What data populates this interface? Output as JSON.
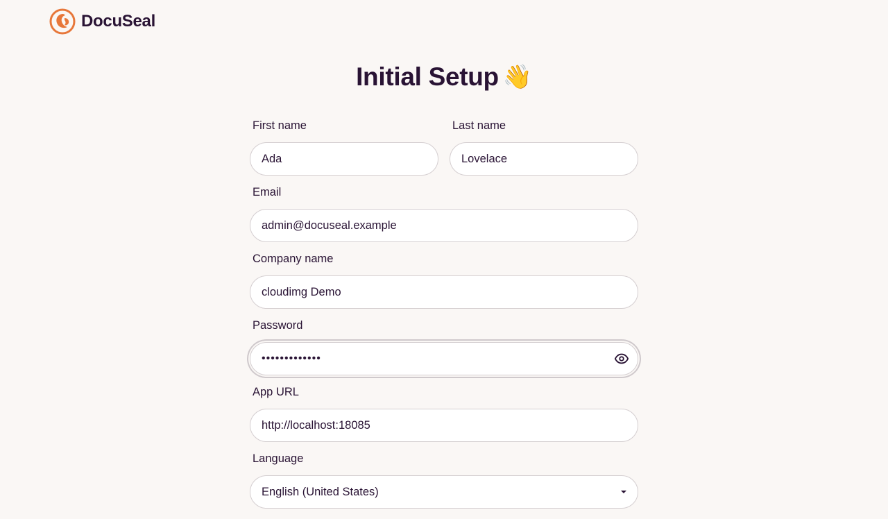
{
  "header": {
    "brand": "DocuSeal",
    "logo_icon": "docuseal-logo-icon",
    "accent_color": "#e7773a"
  },
  "page": {
    "title": "Initial Setup",
    "title_emoji": "👋"
  },
  "form": {
    "first_name": {
      "label": "First name",
      "value": "Ada"
    },
    "last_name": {
      "label": "Last name",
      "value": "Lovelace"
    },
    "email": {
      "label": "Email",
      "value": "admin@docuseal.example"
    },
    "company": {
      "label": "Company name",
      "value": "cloudimg Demo"
    },
    "password": {
      "label": "Password",
      "masked_value": "•••••••••••••",
      "toggle_icon": "eye-icon"
    },
    "app_url": {
      "label": "App URL",
      "value": "http://localhost:18085"
    },
    "language": {
      "label": "Language",
      "selected": "English (United States)",
      "caret_icon": "caret-down-icon"
    }
  }
}
